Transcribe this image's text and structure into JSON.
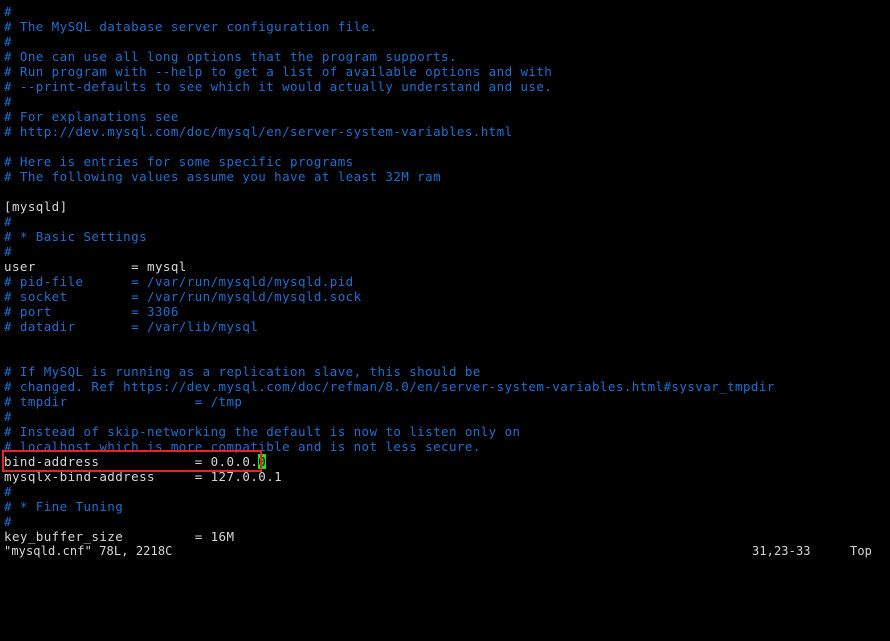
{
  "terminal": {
    "background_color": "#000000",
    "comment_color": "#1f6fd0",
    "setting_color": "#d6d6d6",
    "cursor_color": "#19e619",
    "highlight_color": "#ef2020"
  },
  "editor": {
    "lines": [
      {
        "text": "#",
        "kind": "comment"
      },
      {
        "text": "# The MySQL database server configuration file.",
        "kind": "comment"
      },
      {
        "text": "#",
        "kind": "comment"
      },
      {
        "text": "# One can use all long options that the program supports.",
        "kind": "comment"
      },
      {
        "text": "# Run program with --help to get a list of available options and with",
        "kind": "comment"
      },
      {
        "text": "# --print-defaults to see which it would actually understand and use.",
        "kind": "comment"
      },
      {
        "text": "#",
        "kind": "comment"
      },
      {
        "text": "# For explanations see",
        "kind": "comment"
      },
      {
        "text": "# http://dev.mysql.com/doc/mysql/en/server-system-variables.html",
        "kind": "comment"
      },
      {
        "text": "",
        "kind": "blank"
      },
      {
        "text": "# Here is entries for some specific programs",
        "kind": "comment"
      },
      {
        "text": "# The following values assume you have at least 32M ram",
        "kind": "comment"
      },
      {
        "text": "",
        "kind": "blank"
      },
      {
        "text": "[mysqld]",
        "kind": "setting"
      },
      {
        "text": "#",
        "kind": "comment"
      },
      {
        "text": "# * Basic Settings",
        "kind": "comment"
      },
      {
        "text": "#",
        "kind": "comment"
      },
      {
        "text": "user            = mysql",
        "kind": "setting"
      },
      {
        "text": "# pid-file      = /var/run/mysqld/mysqld.pid",
        "kind": "comment"
      },
      {
        "text": "# socket        = /var/run/mysqld/mysqld.sock",
        "kind": "comment"
      },
      {
        "text": "# port          = 3306",
        "kind": "comment"
      },
      {
        "text": "# datadir       = /var/lib/mysql",
        "kind": "comment"
      },
      {
        "text": "",
        "kind": "blank"
      },
      {
        "text": "",
        "kind": "blank"
      },
      {
        "text": "# If MySQL is running as a replication slave, this should be",
        "kind": "comment"
      },
      {
        "text": "# changed. Ref https://dev.mysql.com/doc/refman/8.0/en/server-system-variables.html#sysvar_tmpdir",
        "kind": "comment"
      },
      {
        "text": "# tmpdir                = /tmp",
        "kind": "comment"
      },
      {
        "text": "#",
        "kind": "comment"
      },
      {
        "text": "# Instead of skip-networking the default is now to listen only on",
        "kind": "comment"
      },
      {
        "text": "# localhost which is more compatible and is not less secure.",
        "kind": "comment"
      },
      {
        "text": "bind-address            = 0.0.0.0",
        "kind": "setting",
        "cursor_at": 32
      },
      {
        "text": "mysqlx-bind-address     = 127.0.0.1",
        "kind": "setting"
      },
      {
        "text": "#",
        "kind": "comment"
      },
      {
        "text": "# * Fine Tuning",
        "kind": "comment"
      },
      {
        "text": "#",
        "kind": "comment"
      },
      {
        "text": "key_buffer_size         = 16M",
        "kind": "setting"
      }
    ]
  },
  "status_bar": {
    "file_info": "\"mysqld.cnf\" 78L, 2218C",
    "cursor_position": "31,23-33",
    "scroll_position": "Top"
  }
}
